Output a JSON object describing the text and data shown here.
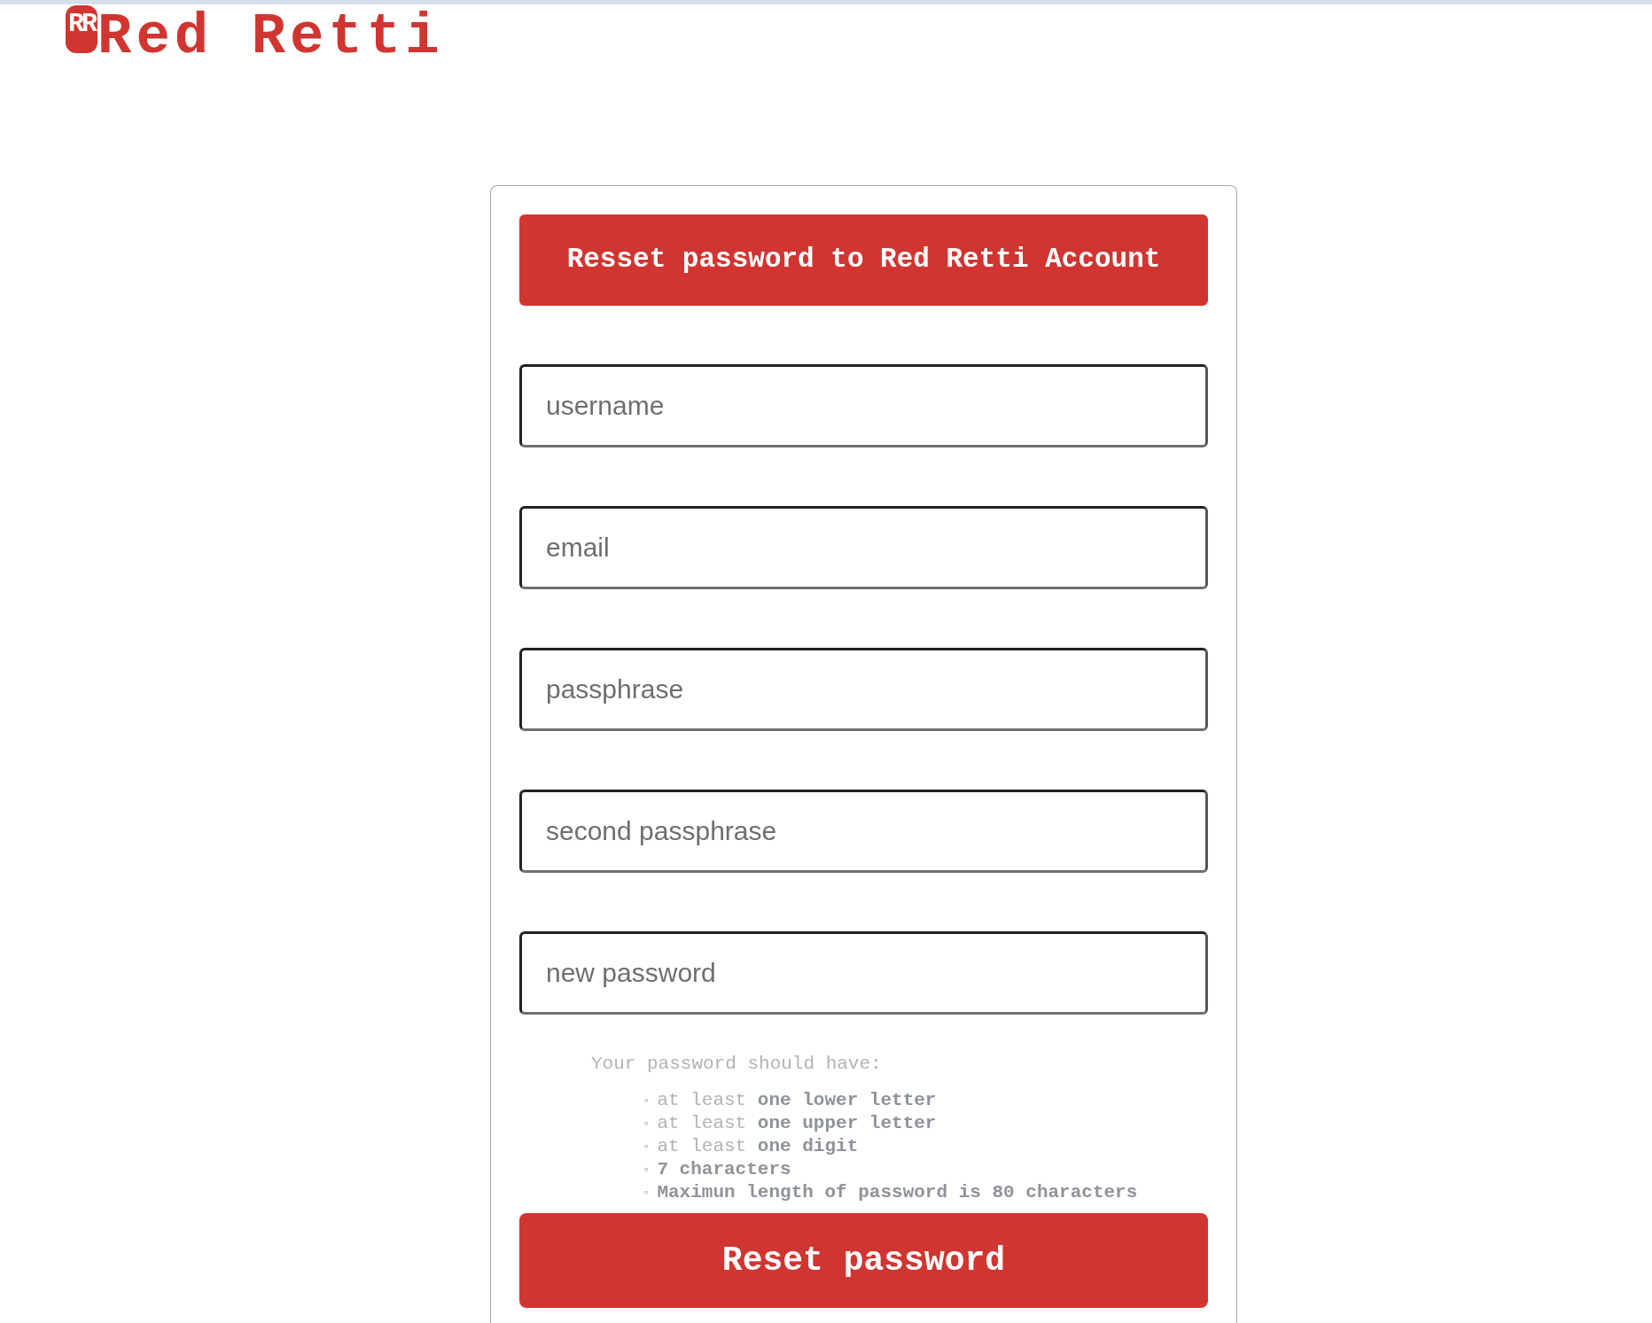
{
  "logo": {
    "badge": "RR",
    "name": "Red Retti"
  },
  "form": {
    "title": "Resset password to Red Retti Account",
    "fields": [
      {
        "placeholder": "username"
      },
      {
        "placeholder": "email"
      },
      {
        "placeholder": "passphrase"
      },
      {
        "placeholder": "second passphrase"
      },
      {
        "placeholder": "new password"
      }
    ],
    "rules_title": "Your password should have:",
    "rules": [
      {
        "marker": "◦",
        "text": "at least **one lower letter**",
        "bold": false
      },
      {
        "marker": "◦",
        "text": "at least **one upper letter**",
        "bold": false
      },
      {
        "marker": "◦",
        "text": "at least **one digit**",
        "bold": false
      },
      {
        "marker": "◦",
        "text": "7 characters",
        "bold": true
      },
      {
        "marker": "◦",
        "text": "Maximun length of password is 80 characters",
        "bold": true
      }
    ],
    "submit": "Reset password"
  }
}
